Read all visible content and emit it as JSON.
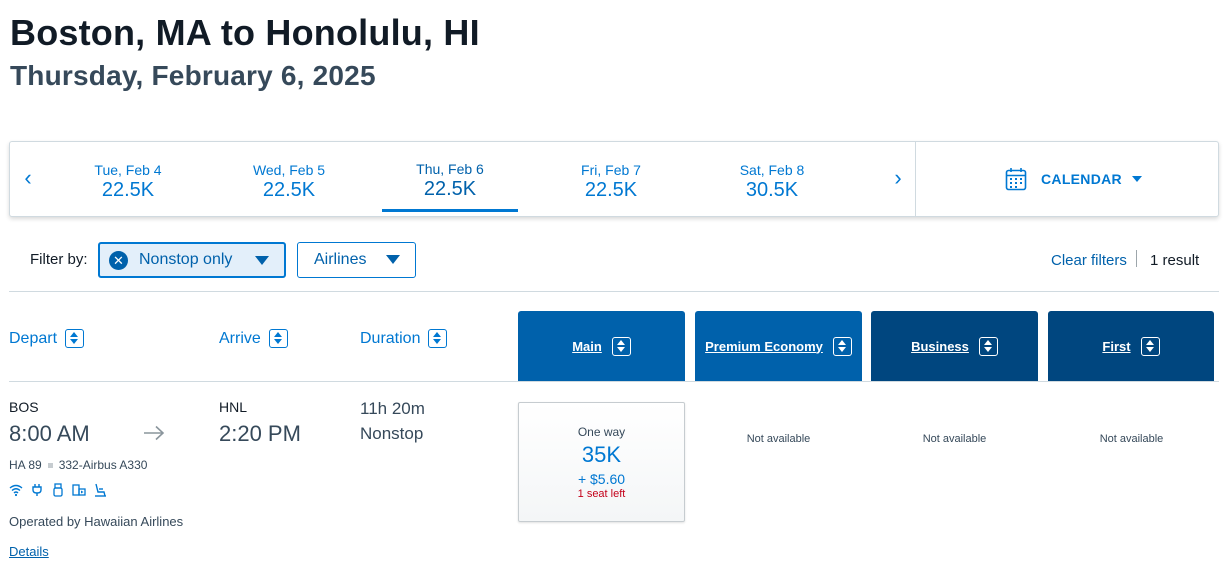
{
  "header": {
    "route": "Boston, MA to Honolulu, HI",
    "date": "Thursday, February 6, 2025"
  },
  "date_strip": {
    "dates": [
      {
        "day": "Tue, Feb 4",
        "price": "22.5K"
      },
      {
        "day": "Wed, Feb 5",
        "price": "22.5K"
      },
      {
        "day": "Thu, Feb 6",
        "price": "22.5K",
        "selected": true
      },
      {
        "day": "Fri, Feb 7",
        "price": "22.5K"
      },
      {
        "day": "Sat, Feb 8",
        "price": "30.5K"
      }
    ],
    "prev_arrow": "‹",
    "next_arrow": "›",
    "calendar_label": "CALENDAR"
  },
  "filters": {
    "label": "Filter by:",
    "nonstop_label": "Nonstop only",
    "airlines_label": "Airlines",
    "clear_label": "Clear filters",
    "result_count": "1 result"
  },
  "columns": {
    "depart": "Depart",
    "arrive": "Arrive",
    "duration": "Duration",
    "cabins": [
      "Main",
      "Premium Economy",
      "Business",
      "First"
    ]
  },
  "flight": {
    "depart_code": "BOS",
    "depart_time": "8:00 AM",
    "arrive_code": "HNL",
    "arrive_time": "2:20 PM",
    "duration": "11h 20m",
    "stops": "Nonstop",
    "flight_number": "HA 89",
    "aircraft": "332-Airbus A330",
    "operated_by": "Operated by Hawaiian Airlines",
    "details_label": "Details",
    "amenities": [
      "wifi-icon",
      "power-icon",
      "usb-icon",
      "entertainment-icon",
      "seat-icon"
    ],
    "main_fare": {
      "type": "One way",
      "miles": "35K",
      "taxes": "+ $5.60",
      "seats": "1 seat left"
    },
    "premium_fare": "Not available",
    "business_fare": "Not available",
    "first_fare": "Not available"
  },
  "colors": {
    "accent": "#0078d2",
    "header_main": "#0061ab",
    "header_premium": "#0061ab",
    "header_business": "#00467f",
    "header_first": "#00467f",
    "alert": "#c30019"
  }
}
